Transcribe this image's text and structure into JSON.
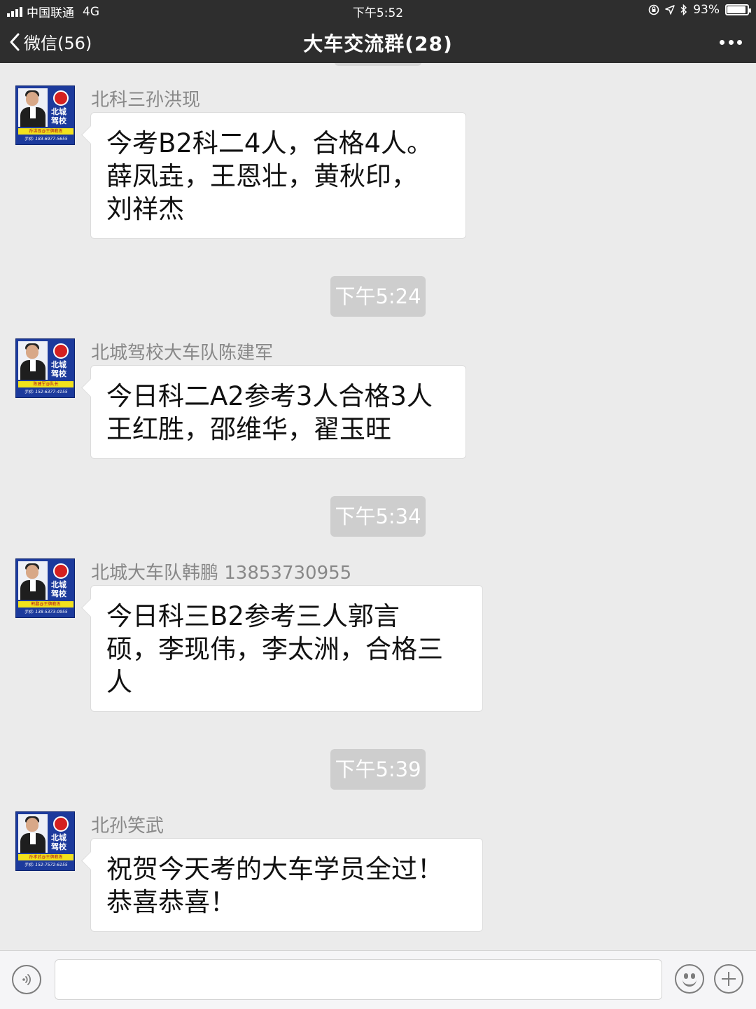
{
  "status_bar": {
    "carrier": "中国联通",
    "network": "4G",
    "time": "下午5:52",
    "battery": "93%",
    "battery_level": 0.93
  },
  "nav": {
    "back_label": "微信(56)",
    "title": "大车交流群(28)"
  },
  "messages": [
    {
      "sender": "北科三孙洪现",
      "text": "今考B2科二4人，合格4人。\n薛凤垚，王恩壮，黄秋印，\n刘祥杰",
      "avatar": {
        "school": "北城\n驾校",
        "band": "孙洪现@王牌教练",
        "phone": "手机: 183-6977-5655"
      }
    },
    {
      "sender": "北城驾校大车队陈建军",
      "text": "今日科二A2参考3人合格3人\n王红胜，邵维华，翟玉旺",
      "avatar": {
        "school": "北城\n驾校",
        "band": "陈建军@队长",
        "phone": "手机: 152-6377-4155"
      }
    },
    {
      "sender": "北城大车队韩鹏 13853730955",
      "text": "今日科三B2参考三人郭言\n硕，李现伟，李太洲，合格三\n人",
      "avatar": {
        "school": "北城\n驾校",
        "band": "韩鹏@王牌教练",
        "phone": "手机: 138-5373-0955"
      }
    },
    {
      "sender": "北孙笑武",
      "text": "祝贺今天考的大车学员全过！\n恭喜恭喜！",
      "avatar": {
        "school": "北城\n驾校",
        "band": "孙孝武@王牌教练",
        "phone": "手机: 152-7572-6155"
      }
    }
  ],
  "timestamps": [
    "下午5:24",
    "下午5:34",
    "下午5:39"
  ],
  "input": {
    "value": "",
    "placeholder": ""
  },
  "icons": {
    "back": "chevron-left-icon",
    "more": "more-dots-icon",
    "voice": "voice-icon",
    "emoji": "emoji-icon",
    "plus": "plus-icon",
    "location": "location-arrow-icon",
    "bluetooth": "bluetooth-icon",
    "lock": "orientation-lock-icon"
  },
  "colors": {
    "header_bg": "#2e2e2e",
    "chat_bg": "#ebebeb",
    "bubble_bg": "#ffffff",
    "timestamp_bg": "#cecece"
  }
}
